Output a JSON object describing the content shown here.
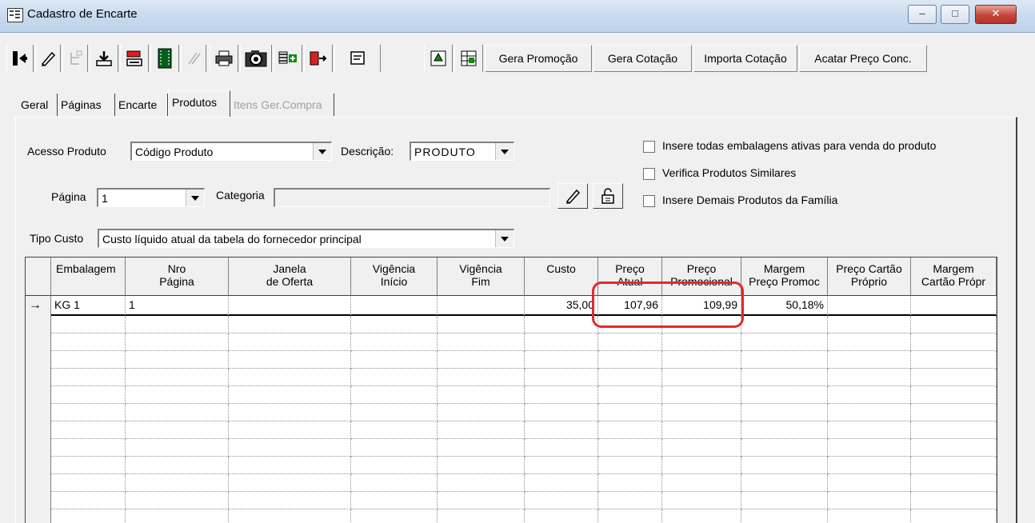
{
  "window": {
    "title": "Cadastro de Encarte",
    "min_label": "–",
    "max_label": "□",
    "close_label": "✕"
  },
  "toolbar": {
    "icons": [
      "exit-icon",
      "edit-icon",
      "tree-disabled-icon",
      "import-icon",
      "export-icon",
      "film-icon",
      "brush-disabled-icon",
      "print-icon",
      "camera-icon",
      "insert-row-icon",
      "move-out-icon",
      "notes-icon",
      "refresh-icon",
      "grid-icon"
    ],
    "gera_promocao": "Gera Promoção",
    "gera_cotacao": "Gera Cotação",
    "importa_cotacao": "Importa Cotação",
    "acatar_preco": "Acatar Preço Conc."
  },
  "tabs": [
    {
      "label": "Geral"
    },
    {
      "label": "Páginas"
    },
    {
      "label": "Encarte"
    },
    {
      "label": "Produtos",
      "active": true
    },
    {
      "label": "Itens Ger.Compra",
      "disabled": true
    }
  ],
  "form": {
    "acesso_produto_label": "Acesso Produto",
    "acesso_produto_value": "Código Produto",
    "descricao_label": "Descrição:",
    "descricao_value": "PRODUTO",
    "pagina_label": "Página",
    "pagina_value": "1",
    "categoria_label": "Categoria",
    "categoria_value": "",
    "tipo_custo_label": "Tipo Custo",
    "tipo_custo_value": "Custo líquido atual da tabela do fornecedor principal",
    "checkboxes": [
      {
        "label": "Insere todas embalagens ativas para venda do produto",
        "checked": false
      },
      {
        "label": "Verifica Produtos Similares",
        "checked": false
      },
      {
        "label": "Insere Demais Produtos da Família",
        "checked": false
      }
    ]
  },
  "grid": {
    "headers": [
      {
        "l1": "Embalagem",
        "l2": ""
      },
      {
        "l1": "Nro",
        "l2": "Página"
      },
      {
        "l1": "Janela",
        "l2": "de Oferta"
      },
      {
        "l1": "Vigência",
        "l2": "Início"
      },
      {
        "l1": "Vigência",
        "l2": "Fim"
      },
      {
        "l1": "Custo",
        "l2": ""
      },
      {
        "l1": "Preço",
        "l2": "Atual"
      },
      {
        "l1": "Preço",
        "l2": "Promocional"
      },
      {
        "l1": "Margem",
        "l2": "Preço Promoc"
      },
      {
        "l1": "Preço Cartão",
        "l2": "Próprio"
      },
      {
        "l1": "Margem",
        "l2": "Cartão Própr"
      }
    ],
    "current_row_marker": "→",
    "rows": [
      [
        "KG  1",
        "1",
        "",
        "",
        "",
        "35,00",
        "107,96",
        "109,99",
        "50,18%",
        "",
        ""
      ]
    ],
    "empty_rows": 13
  }
}
